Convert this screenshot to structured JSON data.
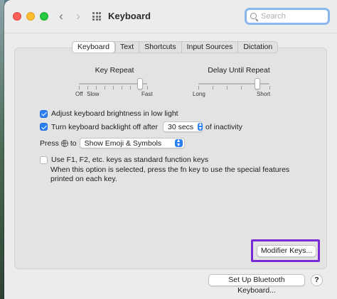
{
  "window": {
    "title": "Keyboard",
    "search_placeholder": "Search"
  },
  "tabs": [
    {
      "label": "Keyboard",
      "active": true
    },
    {
      "label": "Text",
      "active": false
    },
    {
      "label": "Shortcuts",
      "active": false
    },
    {
      "label": "Input Sources",
      "active": false
    },
    {
      "label": "Dictation",
      "active": false
    }
  ],
  "key_repeat": {
    "label": "Key Repeat",
    "ticks": [
      "Off",
      "Slow",
      "Fast"
    ],
    "level": 0.9
  },
  "delay_until_repeat": {
    "label": "Delay Until Repeat",
    "ticks": [
      "Long",
      "Short"
    ],
    "level": 0.83
  },
  "options": {
    "adjust_brightness": {
      "label": "Adjust keyboard brightness in low light",
      "checked": true
    },
    "backlight_off": {
      "label": "Turn keyboard backlight off after",
      "checked": true,
      "value": "30 secs",
      "suffix": "of inactivity"
    },
    "press_globe": {
      "prefix": "Press",
      "to": "to",
      "value": "Show Emoji & Symbols"
    },
    "function_keys": {
      "label": "Use F1, F2, etc. keys as standard function keys",
      "checked": false,
      "description": "When this option is selected, press the fn key to use the special features printed on each key."
    }
  },
  "buttons": {
    "modifier_keys": "Modifier Keys...",
    "bluetooth_keyboard": "Set Up Bluetooth Keyboard...",
    "help": "?"
  },
  "colors": {
    "accent": "#2a7ff5",
    "highlight_box": "#7b2bd6"
  }
}
